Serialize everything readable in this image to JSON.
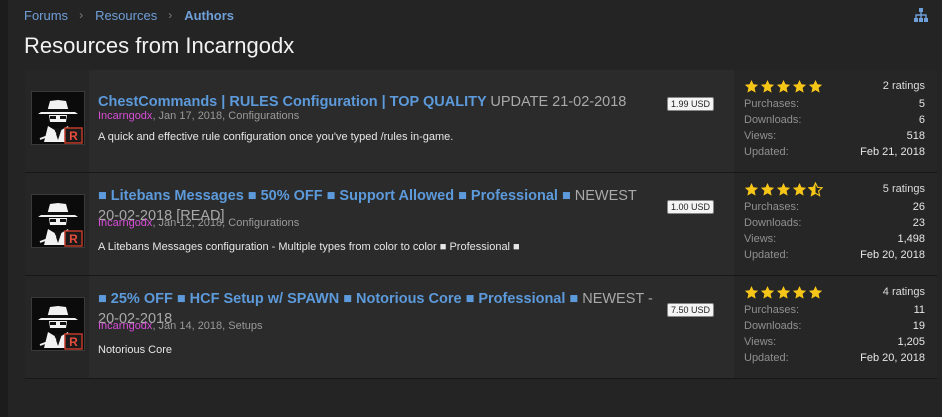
{
  "breadcrumb": [
    "Forums",
    "Resources",
    "Authors"
  ],
  "page_title": "Resources from Incarngodx",
  "icons": {
    "breadcrumb_sep": "chevron-right-icon",
    "sitemap": "sitemap-icon",
    "avatar": "spy-avatar-icon",
    "rating": "star-icon"
  },
  "colors": {
    "link": "#5c9adb",
    "author": "#d84ed8",
    "star": "#f5c518"
  },
  "stats_labels": {
    "purchases": "Purchases:",
    "downloads": "Downloads:",
    "views": "Views:",
    "updated": "Updated:"
  },
  "resources": [
    {
      "title": "ChestCommands | RULES Configuration | TOP QUALITY",
      "title_suffix": "UPDATE 21-02-2018",
      "price": "1.99 USD",
      "author": "Incarngodx",
      "meta_rest": ", Jan 17, 2018, Configurations",
      "tagline": "A quick and effective rule configuration once you've typed /rules in-game.",
      "stars": 5,
      "ratings": "2 ratings",
      "purchases": "5",
      "downloads": "6",
      "views": "518",
      "updated": "Feb 21, 2018"
    },
    {
      "title": "■ Litebans Messages ■ 50% OFF ■ Support Allowed ■ Professional ■",
      "title_suffix": "NEWEST 20-02-2018 [READ]",
      "price": "1.00 USD",
      "author": "Incarngodx",
      "meta_rest": ", Jan 12, 2018, Configurations",
      "tagline": "A Litebans Messages configuration - Multiple types from color to color ■ Professional ■",
      "stars": 4.5,
      "ratings": "5 ratings",
      "purchases": "26",
      "downloads": "23",
      "views": "1,498",
      "updated": "Feb 20, 2018"
    },
    {
      "title": "■ 25% OFF ■ HCF Setup w/ SPAWN ■ Notorious Core ■ Professional ■",
      "title_suffix": "NEWEST - 20-02-2018",
      "price": "7.50 USD",
      "author": "Incarngodx",
      "meta_rest": ", Jan 14, 2018, Setups",
      "tagline": "Notorious Core",
      "stars": 5,
      "ratings": "4 ratings",
      "purchases": "11",
      "downloads": "19",
      "views": "1,205",
      "updated": "Feb 20, 2018"
    }
  ]
}
